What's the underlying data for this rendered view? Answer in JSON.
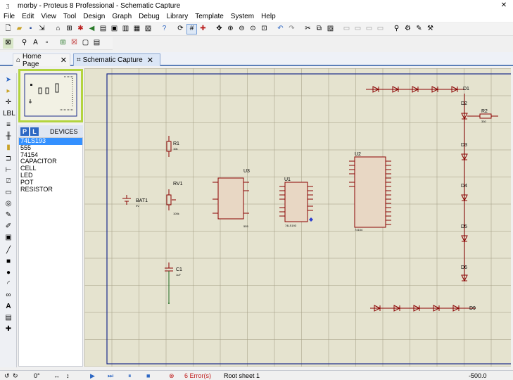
{
  "window": {
    "title": "morby - Proteus 8 Professional - Schematic Capture"
  },
  "menu": [
    "File",
    "Edit",
    "View",
    "Tool",
    "Design",
    "Graph",
    "Debug",
    "Library",
    "Template",
    "System",
    "Help"
  ],
  "tabs": [
    {
      "label": "Home Page",
      "close": "✕"
    },
    {
      "label": "Schematic Capture",
      "close": "✕"
    }
  ],
  "devices": {
    "mode_p": "P",
    "mode_l": "L",
    "title": "DEVICES",
    "items": [
      "74LS193",
      "555",
      "74154",
      "CAPACITOR",
      "CELL",
      "LED",
      "POT",
      "RESISTOR"
    ],
    "selected": "74LS193"
  },
  "schematic": {
    "r1": {
      "ref": "R1",
      "value": "10k"
    },
    "rv1": {
      "ref": "RV1",
      "value": "100k"
    },
    "bat1": {
      "ref": "BAT1",
      "value": "9V"
    },
    "c1": {
      "ref": "C1",
      "value": "1uF"
    },
    "u3": {
      "ref": "U3",
      "part": "555"
    },
    "u1": {
      "ref": "U1",
      "part": "74LS193"
    },
    "u2": {
      "ref": "U2",
      "part": "74154"
    },
    "r2": {
      "ref": "R2",
      "value": "330"
    },
    "led_top": [
      "D1"
    ],
    "led_right": [
      "D2",
      "D3",
      "D4",
      "D5",
      "D6"
    ],
    "led_bottom": [
      "D9"
    ],
    "led_sublabel": "LED"
  },
  "status": {
    "rotation": "0°",
    "errors": "6 Error(s)",
    "sheet": "Root sheet 1",
    "coord": "-500.0"
  }
}
